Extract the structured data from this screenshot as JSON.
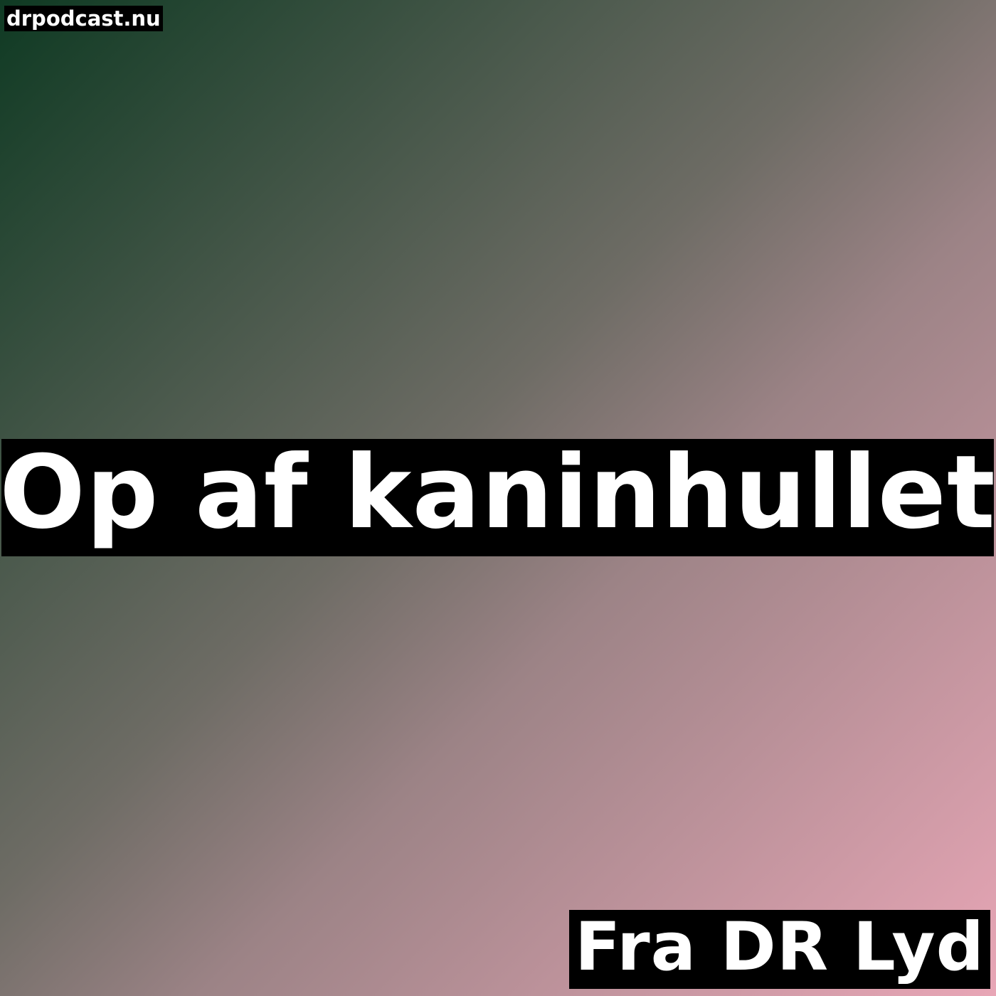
{
  "site": "drpodcast.nu",
  "title": "Op af kaninhullet",
  "source": "Fra DR Lyd",
  "colors": {
    "gradient_start": "#0f3a23",
    "gradient_mid": "#6e6c65",
    "gradient_end": "#e8a6b6",
    "band": "#000000",
    "text": "#ffffff"
  }
}
